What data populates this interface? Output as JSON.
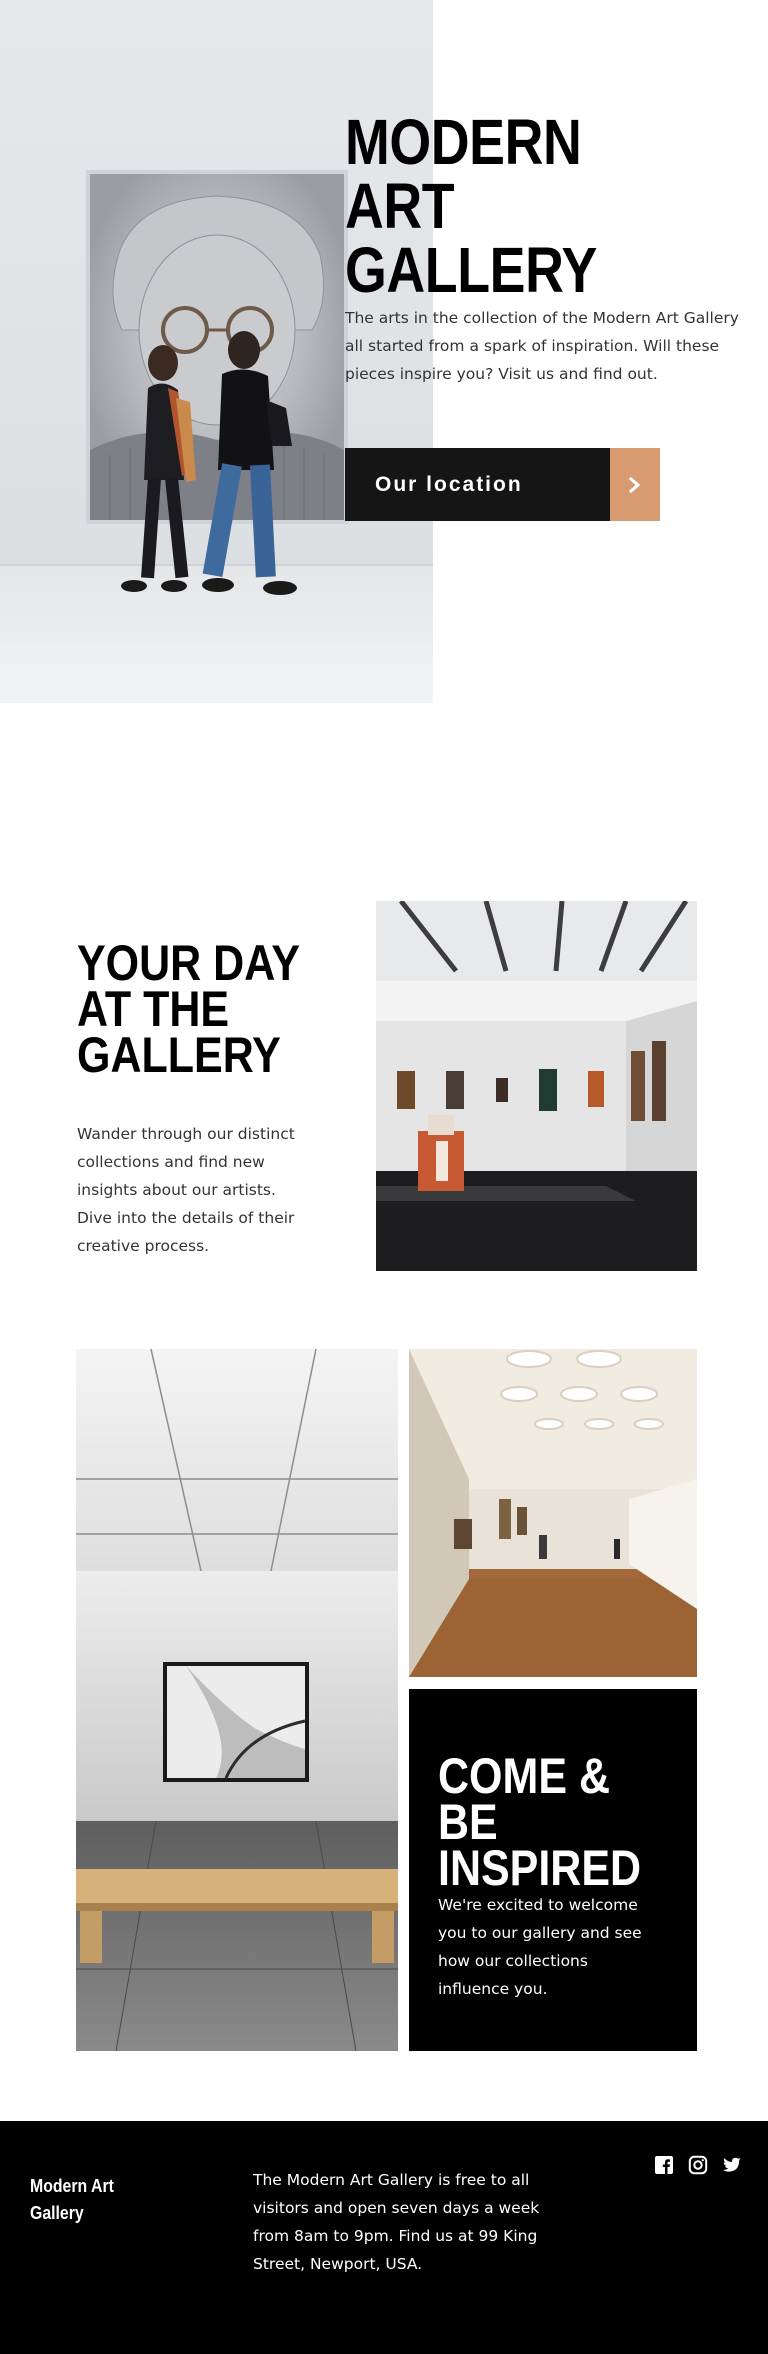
{
  "hero": {
    "title": "MODERN ART GALLERY",
    "description": "The arts in the collection of the Modern Art Gallery all started from a spark of inspiration. Will these pieces inspire you? Visit us and find out.",
    "button_label": "Our location",
    "button_icon": "chevron-right-icon",
    "image": "gallery-visitors-portrait-image"
  },
  "day_section": {
    "title": "YOUR DAY AT THE GALLERY",
    "description_line1": "Wander through our distinct collections and find new insights about our artists.",
    "description_line2": "Dive into the details of their creative process.",
    "image": "gallery-room-image"
  },
  "inspired_section": {
    "title": "COME & BE INSPIRED",
    "description": "We're excited to welcome you to our gallery and see how our collections influence you.",
    "image_left": "bench-room-image",
    "image_right": "gallery-hall-image"
  },
  "footer": {
    "logo": "Modern Art Gallery",
    "info": "The Modern Art Gallery is free to all visitors and open seven days a week from 8am to 9pm. Find us at 99 King Street, Newport, USA.",
    "socials": [
      "facebook-icon",
      "instagram-icon",
      "twitter-icon"
    ]
  },
  "colors": {
    "accent": "#d89a70",
    "dark": "#151515",
    "black": "#000000",
    "white": "#ffffff"
  }
}
